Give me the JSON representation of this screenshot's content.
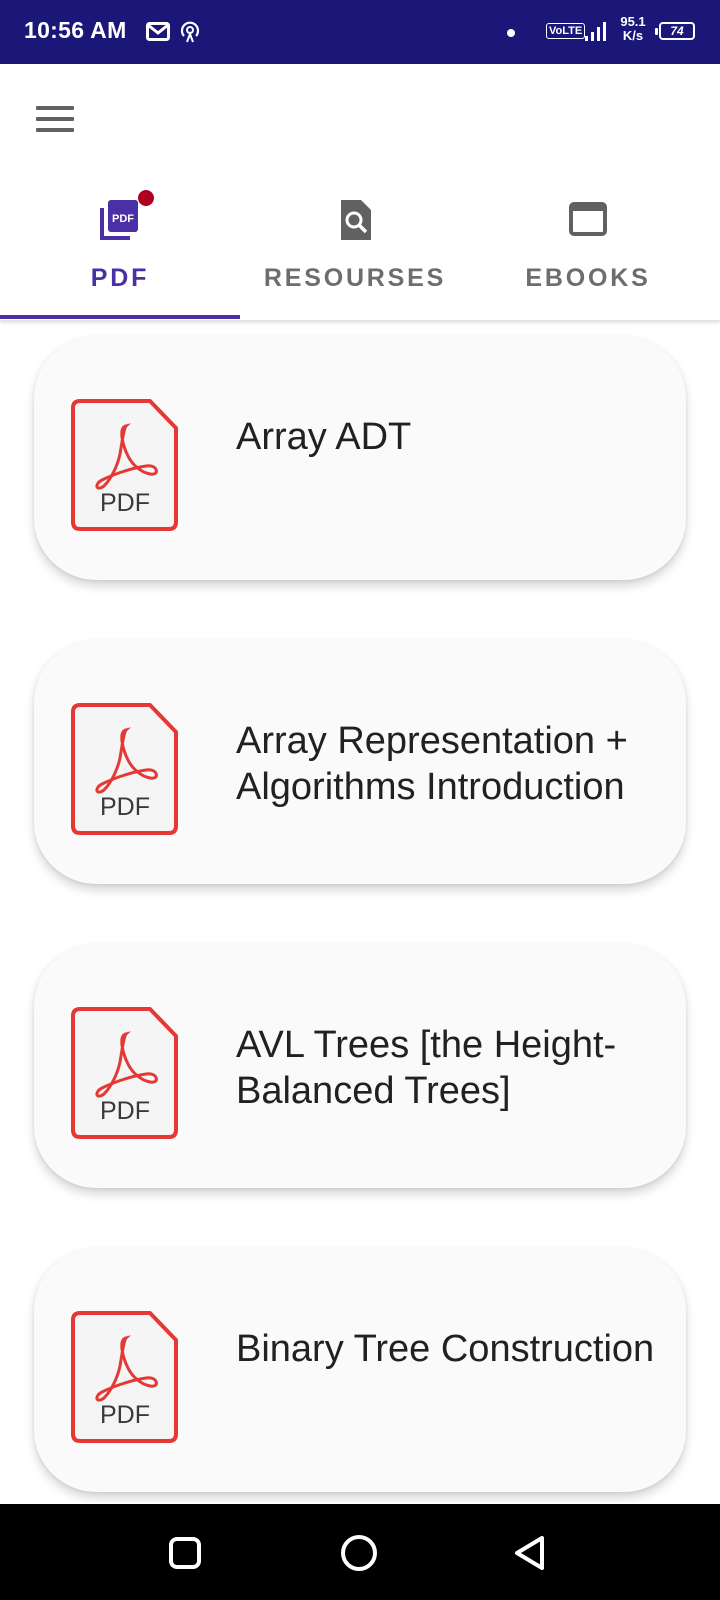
{
  "status_bar": {
    "time": "10:56 AM",
    "volte": "VoLTE",
    "speed_value": "95.1",
    "speed_unit": "K/s",
    "battery": "74",
    "icons": [
      "gmail-icon",
      "hotspot-icon",
      "dot-icon",
      "volte-icon",
      "signal-icon",
      "battery-icon"
    ]
  },
  "app_bar": {
    "menu_icon": "hamburger-menu-icon"
  },
  "tabs": [
    {
      "label": "PDF",
      "icon": "pdf-file-icon",
      "active": true,
      "badge": true
    },
    {
      "label": "RESOURSES",
      "icon": "file-search-icon",
      "active": false
    },
    {
      "label": "EBOOKS",
      "icon": "window-icon",
      "active": false
    }
  ],
  "documents": [
    {
      "title": "Array ADT",
      "icon_label": "PDF"
    },
    {
      "title": "Array Representation + Algorithms Introduction",
      "icon_label": "PDF"
    },
    {
      "title": "AVL Trees [the Height-Balanced Trees]",
      "icon_label": "PDF"
    },
    {
      "title": "Binary Tree Construction",
      "icon_label": "PDF"
    }
  ],
  "nav_bar": {
    "buttons": [
      "recents-square-icon",
      "home-circle-icon",
      "back-triangle-icon"
    ]
  },
  "colors": {
    "status_bar": "#1b1778",
    "accent": "#4a2fa6",
    "badge": "#b00020",
    "pdf_red": "#e53935",
    "card_bg": "#fafafa"
  }
}
